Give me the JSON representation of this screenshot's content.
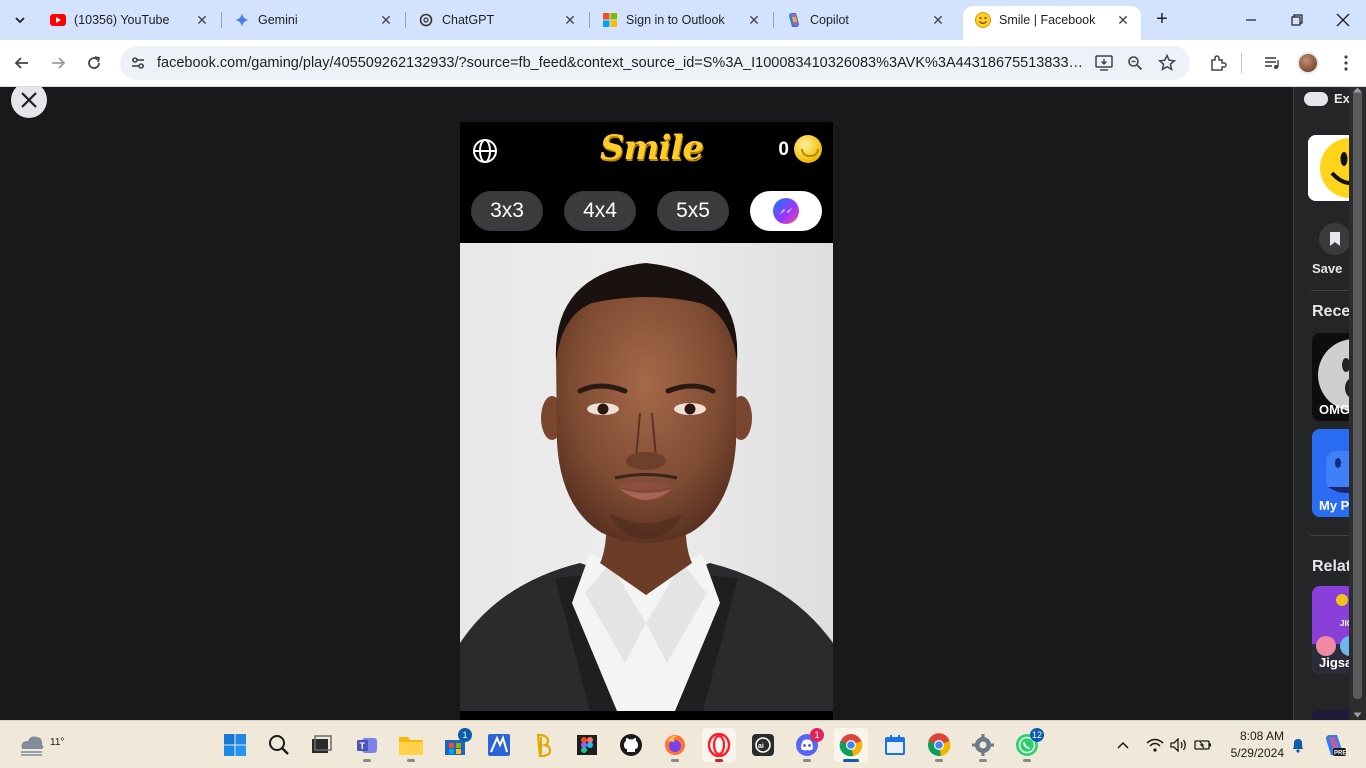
{
  "browser": {
    "tabs": [
      {
        "title": "(10356) YouTube",
        "icon": "youtube-icon",
        "active": false
      },
      {
        "title": "Gemini",
        "icon": "gemini-icon",
        "active": false
      },
      {
        "title": "ChatGPT",
        "icon": "chatgpt-icon",
        "active": false
      },
      {
        "title": "Sign in to Outlook",
        "icon": "microsoft-icon",
        "active": false
      },
      {
        "title": "Copilot",
        "icon": "copilot-icon",
        "active": false
      },
      {
        "title": "Smile | Facebook",
        "icon": "smile-emoji-icon",
        "active": true
      }
    ],
    "url": "facebook.com/gaming/play/405509262132933/?source=fb_feed&context_source_id=S%3A_I100083410326083%3AVK%3A443186755138332&conte..."
  },
  "game": {
    "logo": "Smile",
    "coins": "0",
    "modes": [
      "3x3",
      "4x4",
      "5x5"
    ],
    "share_icon": "messenger-icon"
  },
  "sidebar": {
    "exit_label": "Exi",
    "save_label": "Save",
    "recent_heading": "Recen",
    "recent_games": [
      {
        "label": "OMG"
      },
      {
        "label": "My P"
      }
    ],
    "related_heading": "Relate",
    "related_games": [
      {
        "label": "Jigsa",
        "art_text": "JIGSAW PUZZ"
      }
    ]
  },
  "taskbar": {
    "weather_temp": "11°",
    "apps": [
      {
        "name": "start",
        "icon": "windows-start-icon"
      },
      {
        "name": "search",
        "icon": "search-icon"
      },
      {
        "name": "task-view",
        "icon": "task-view-icon"
      },
      {
        "name": "teams",
        "icon": "teams-icon"
      },
      {
        "name": "file-explorer",
        "icon": "folder-icon"
      },
      {
        "name": "store",
        "icon": "store-icon",
        "badge": "1"
      },
      {
        "name": "app-blue",
        "icon": "blue-app-icon"
      },
      {
        "name": "app-yellow",
        "icon": "yellow-app-icon"
      },
      {
        "name": "figma",
        "icon": "figma-icon"
      },
      {
        "name": "github",
        "icon": "github-icon"
      },
      {
        "name": "firefox",
        "icon": "firefox-icon"
      },
      {
        "name": "opera",
        "icon": "opera-icon"
      },
      {
        "name": "app-dark",
        "icon": "dark-app-icon"
      },
      {
        "name": "discord",
        "icon": "discord-icon",
        "badge": "1"
      },
      {
        "name": "chrome",
        "icon": "chrome-icon"
      },
      {
        "name": "calendar",
        "icon": "calendar-icon"
      },
      {
        "name": "chrome-profile",
        "icon": "chrome-profile-icon"
      },
      {
        "name": "settings",
        "icon": "settings-icon"
      },
      {
        "name": "whatsapp",
        "icon": "whatsapp-icon",
        "badge": "12"
      }
    ],
    "time": "8:08 AM",
    "date": "5/29/2024"
  },
  "colors": {
    "page_bg": "#18191a",
    "tab_strip": "#d3e3fd",
    "logo_yellow": "#ffcc29",
    "mode_button": "#3a3b3c",
    "taskbar": "#f0e8d8"
  }
}
